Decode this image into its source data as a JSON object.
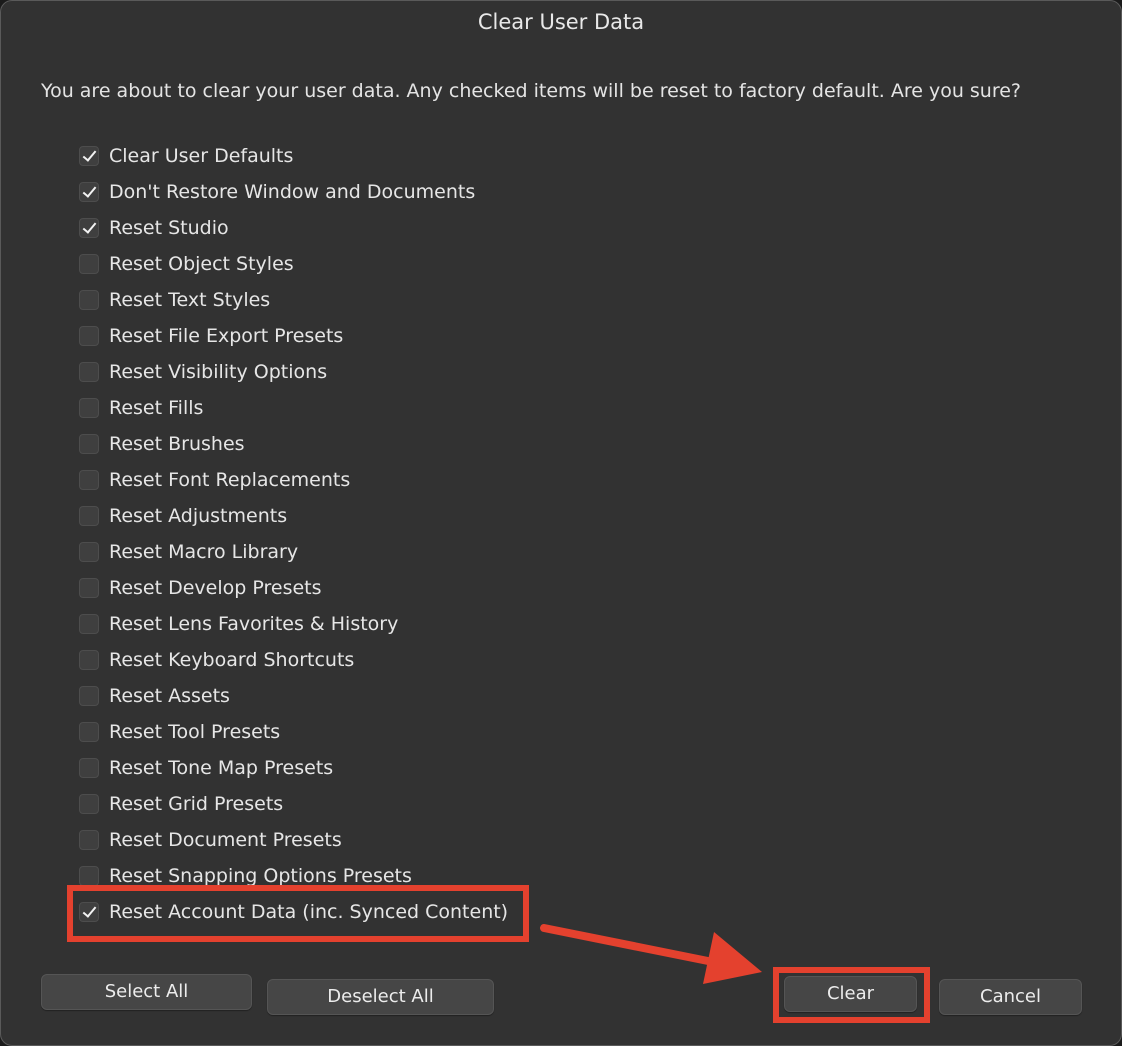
{
  "dialog": {
    "title": "Clear User Data",
    "message": "You are about to clear your user data. Any checked items will be reset to factory default. Are you sure?"
  },
  "options": [
    {
      "label": "Clear User Defaults",
      "checked": true
    },
    {
      "label": "Don't Restore Window and Documents",
      "checked": true
    },
    {
      "label": "Reset Studio",
      "checked": true
    },
    {
      "label": "Reset Object Styles",
      "checked": false
    },
    {
      "label": "Reset Text Styles",
      "checked": false
    },
    {
      "label": "Reset File Export Presets",
      "checked": false
    },
    {
      "label": "Reset Visibility Options",
      "checked": false
    },
    {
      "label": "Reset Fills",
      "checked": false
    },
    {
      "label": "Reset Brushes",
      "checked": false
    },
    {
      "label": "Reset Font Replacements",
      "checked": false
    },
    {
      "label": "Reset Adjustments",
      "checked": false
    },
    {
      "label": "Reset Macro Library",
      "checked": false
    },
    {
      "label": "Reset Develop Presets",
      "checked": false
    },
    {
      "label": "Reset Lens Favorites & History",
      "checked": false
    },
    {
      "label": "Reset Keyboard Shortcuts",
      "checked": false
    },
    {
      "label": "Reset Assets",
      "checked": false
    },
    {
      "label": "Reset Tool Presets",
      "checked": false
    },
    {
      "label": "Reset Tone Map Presets",
      "checked": false
    },
    {
      "label": "Reset Grid Presets",
      "checked": false
    },
    {
      "label": "Reset Document Presets",
      "checked": false
    },
    {
      "label": "Reset Snapping Options Presets",
      "checked": false
    },
    {
      "label": "Reset Account Data (inc. Synced Content)",
      "checked": true
    }
  ],
  "buttons": {
    "select_all": "Select All",
    "deselect_all": "Deselect All",
    "clear": "Clear",
    "cancel": "Cancel"
  },
  "colors": {
    "dialog_background": "#323232",
    "annotation": "#e4412e"
  }
}
